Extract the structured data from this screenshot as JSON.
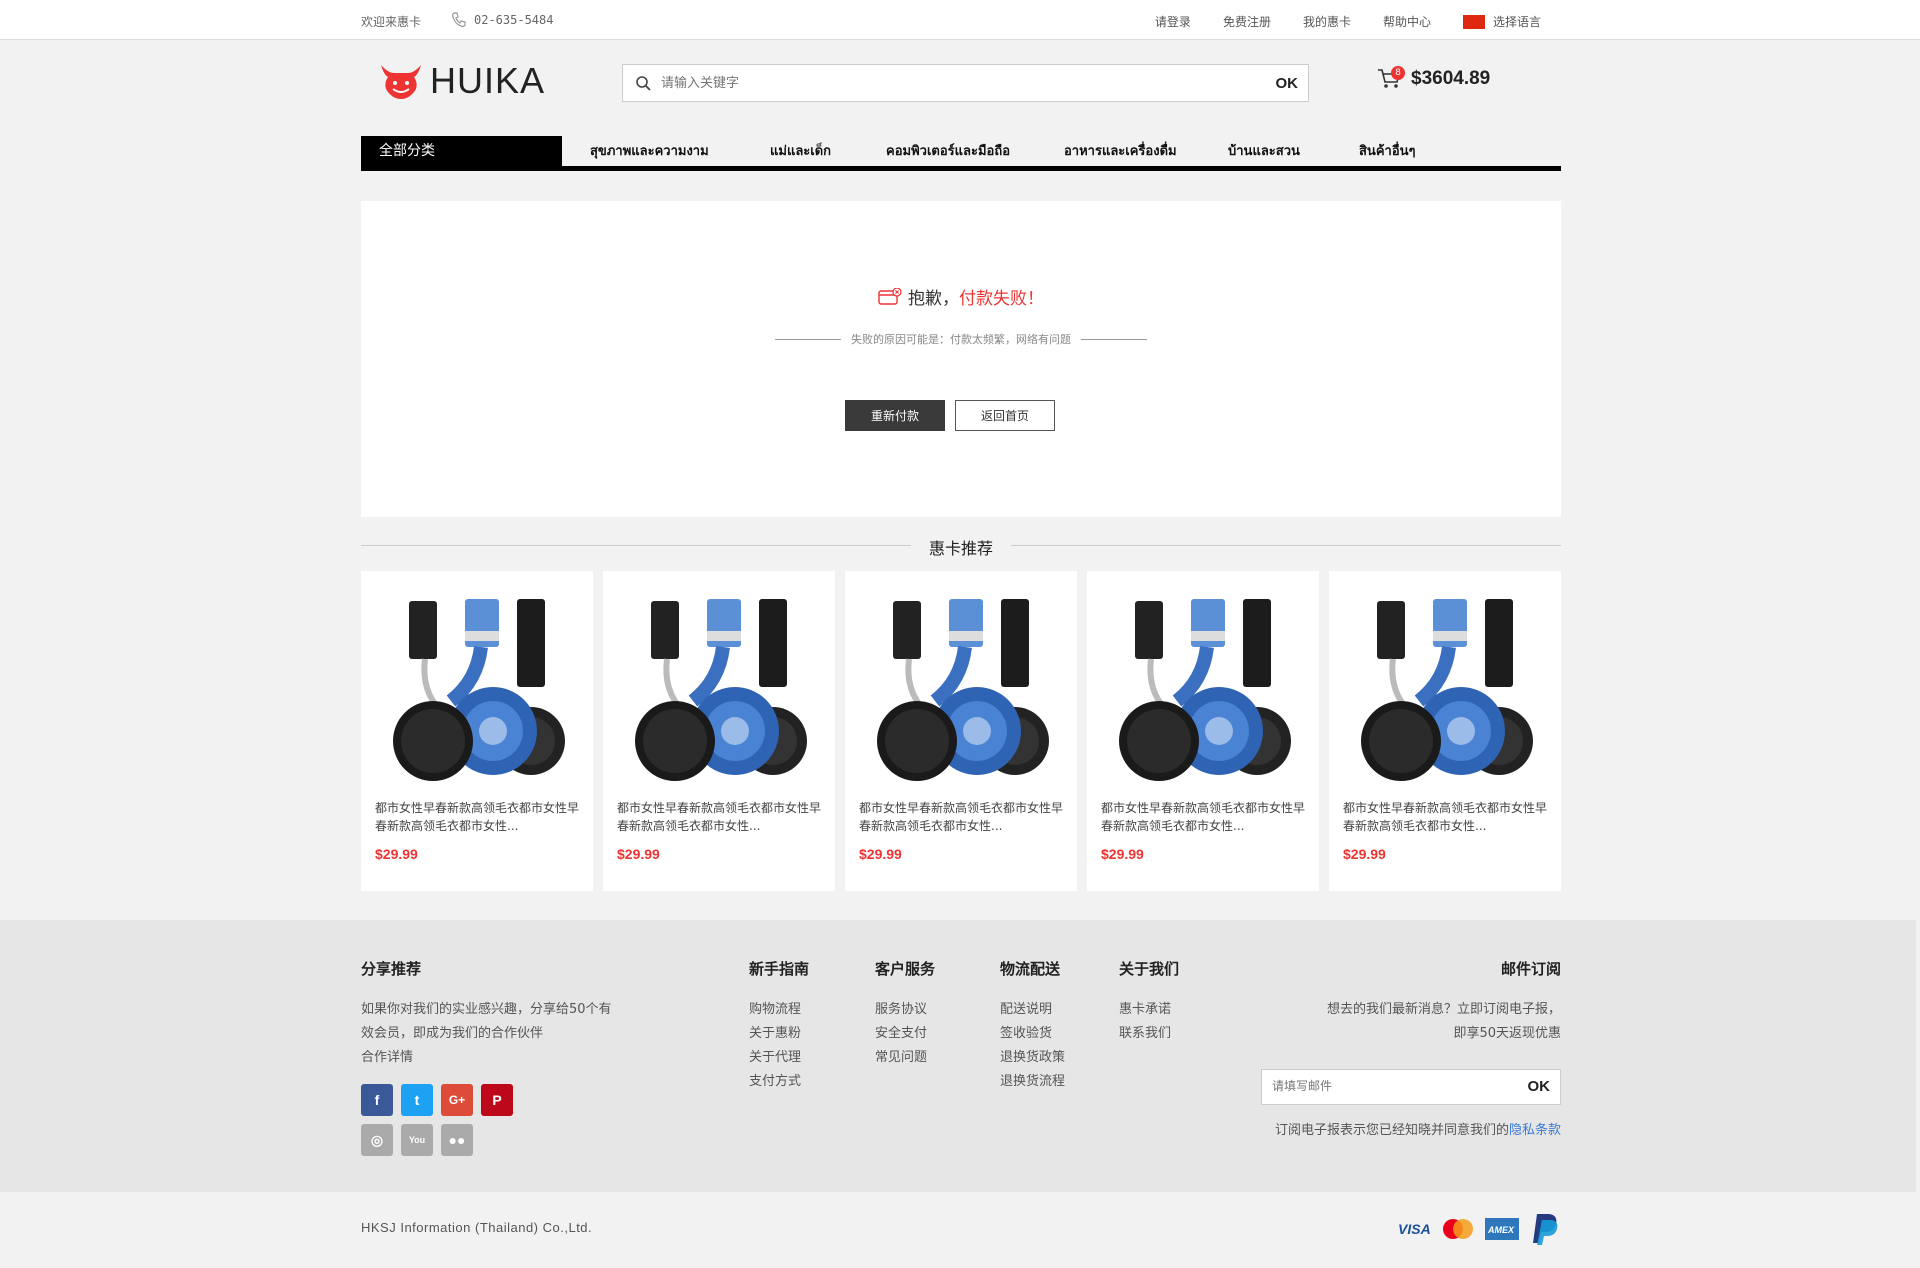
{
  "topbar": {
    "welcome": "欢迎来惠卡",
    "phone": "02-635-5484",
    "links": [
      "请登录",
      "免费注册",
      "我的惠卡",
      "帮助中心"
    ],
    "language": "选择语言"
  },
  "header": {
    "logo_text": "HUIKA",
    "search_placeholder": "请输入关键字",
    "search_button": "OK",
    "cart_count": "8",
    "cart_total": "$3604.89"
  },
  "nav": {
    "all_categories": "全部分类",
    "items": [
      "สุขภาพและความงาม",
      "แม่และเด็ก",
      "คอมพิวเตอร์และมือถือ",
      "อาหารและเครื่องดื่ม",
      "บ้านและสวน",
      "สินค้าอื่นๆ"
    ]
  },
  "result": {
    "sorry": "抱歉，",
    "failed": "付款失败！",
    "reason": "失败的原因可能是：付款太频繁，网络有问题",
    "retry_button": "重新付款",
    "home_button": "返回首页"
  },
  "recommend": {
    "title": "惠卡推荐",
    "products": [
      {
        "name": "都市女性早春新款高领毛衣都市女性早春新款高领毛衣都市女性...",
        "price": "$29.99"
      },
      {
        "name": "都市女性早春新款高领毛衣都市女性早春新款高领毛衣都市女性...",
        "price": "$29.99"
      },
      {
        "name": "都市女性早春新款高领毛衣都市女性早春新款高领毛衣都市女性...",
        "price": "$29.99"
      },
      {
        "name": "都市女性早春新款高领毛衣都市女性早春新款高领毛衣都市女性...",
        "price": "$29.99"
      },
      {
        "name": "都市女性早春新款高领毛衣都市女性早春新款高领毛衣都市女性...",
        "price": "$29.99"
      }
    ]
  },
  "footer": {
    "share": {
      "title": "分享推荐",
      "text": "如果你对我们的实业感兴趣，分享给50个有效会员，即成为我们的合作伙伴",
      "link": "合作详情"
    },
    "columns": [
      {
        "title": "新手指南",
        "items": [
          "购物流程",
          "关于惠粉",
          "关于代理",
          "支付方式"
        ]
      },
      {
        "title": "客户服务",
        "items": [
          "服务协议",
          "安全支付",
          "常见问题"
        ]
      },
      {
        "title": "物流配送",
        "items": [
          "配送说明",
          "签收验货",
          "退换货政策",
          "退换货流程"
        ]
      },
      {
        "title": "关于我们",
        "items": [
          "惠卡承诺",
          "联系我们"
        ]
      }
    ],
    "subscribe": {
      "title": "邮件订阅",
      "text": "想去的我们最新消息？立即订阅电子报，即享50天返现优惠",
      "placeholder": "请填写邮件",
      "button": "OK",
      "note": "订阅电子报表示您已经知晓并同意我们的",
      "note_link": "隐私条款"
    },
    "copyright": "HKSJ Information (Thailand) Co.,Ltd."
  },
  "colors": {
    "accent": "#e33333",
    "dark": "#000000",
    "link": "#3a7bd5"
  }
}
